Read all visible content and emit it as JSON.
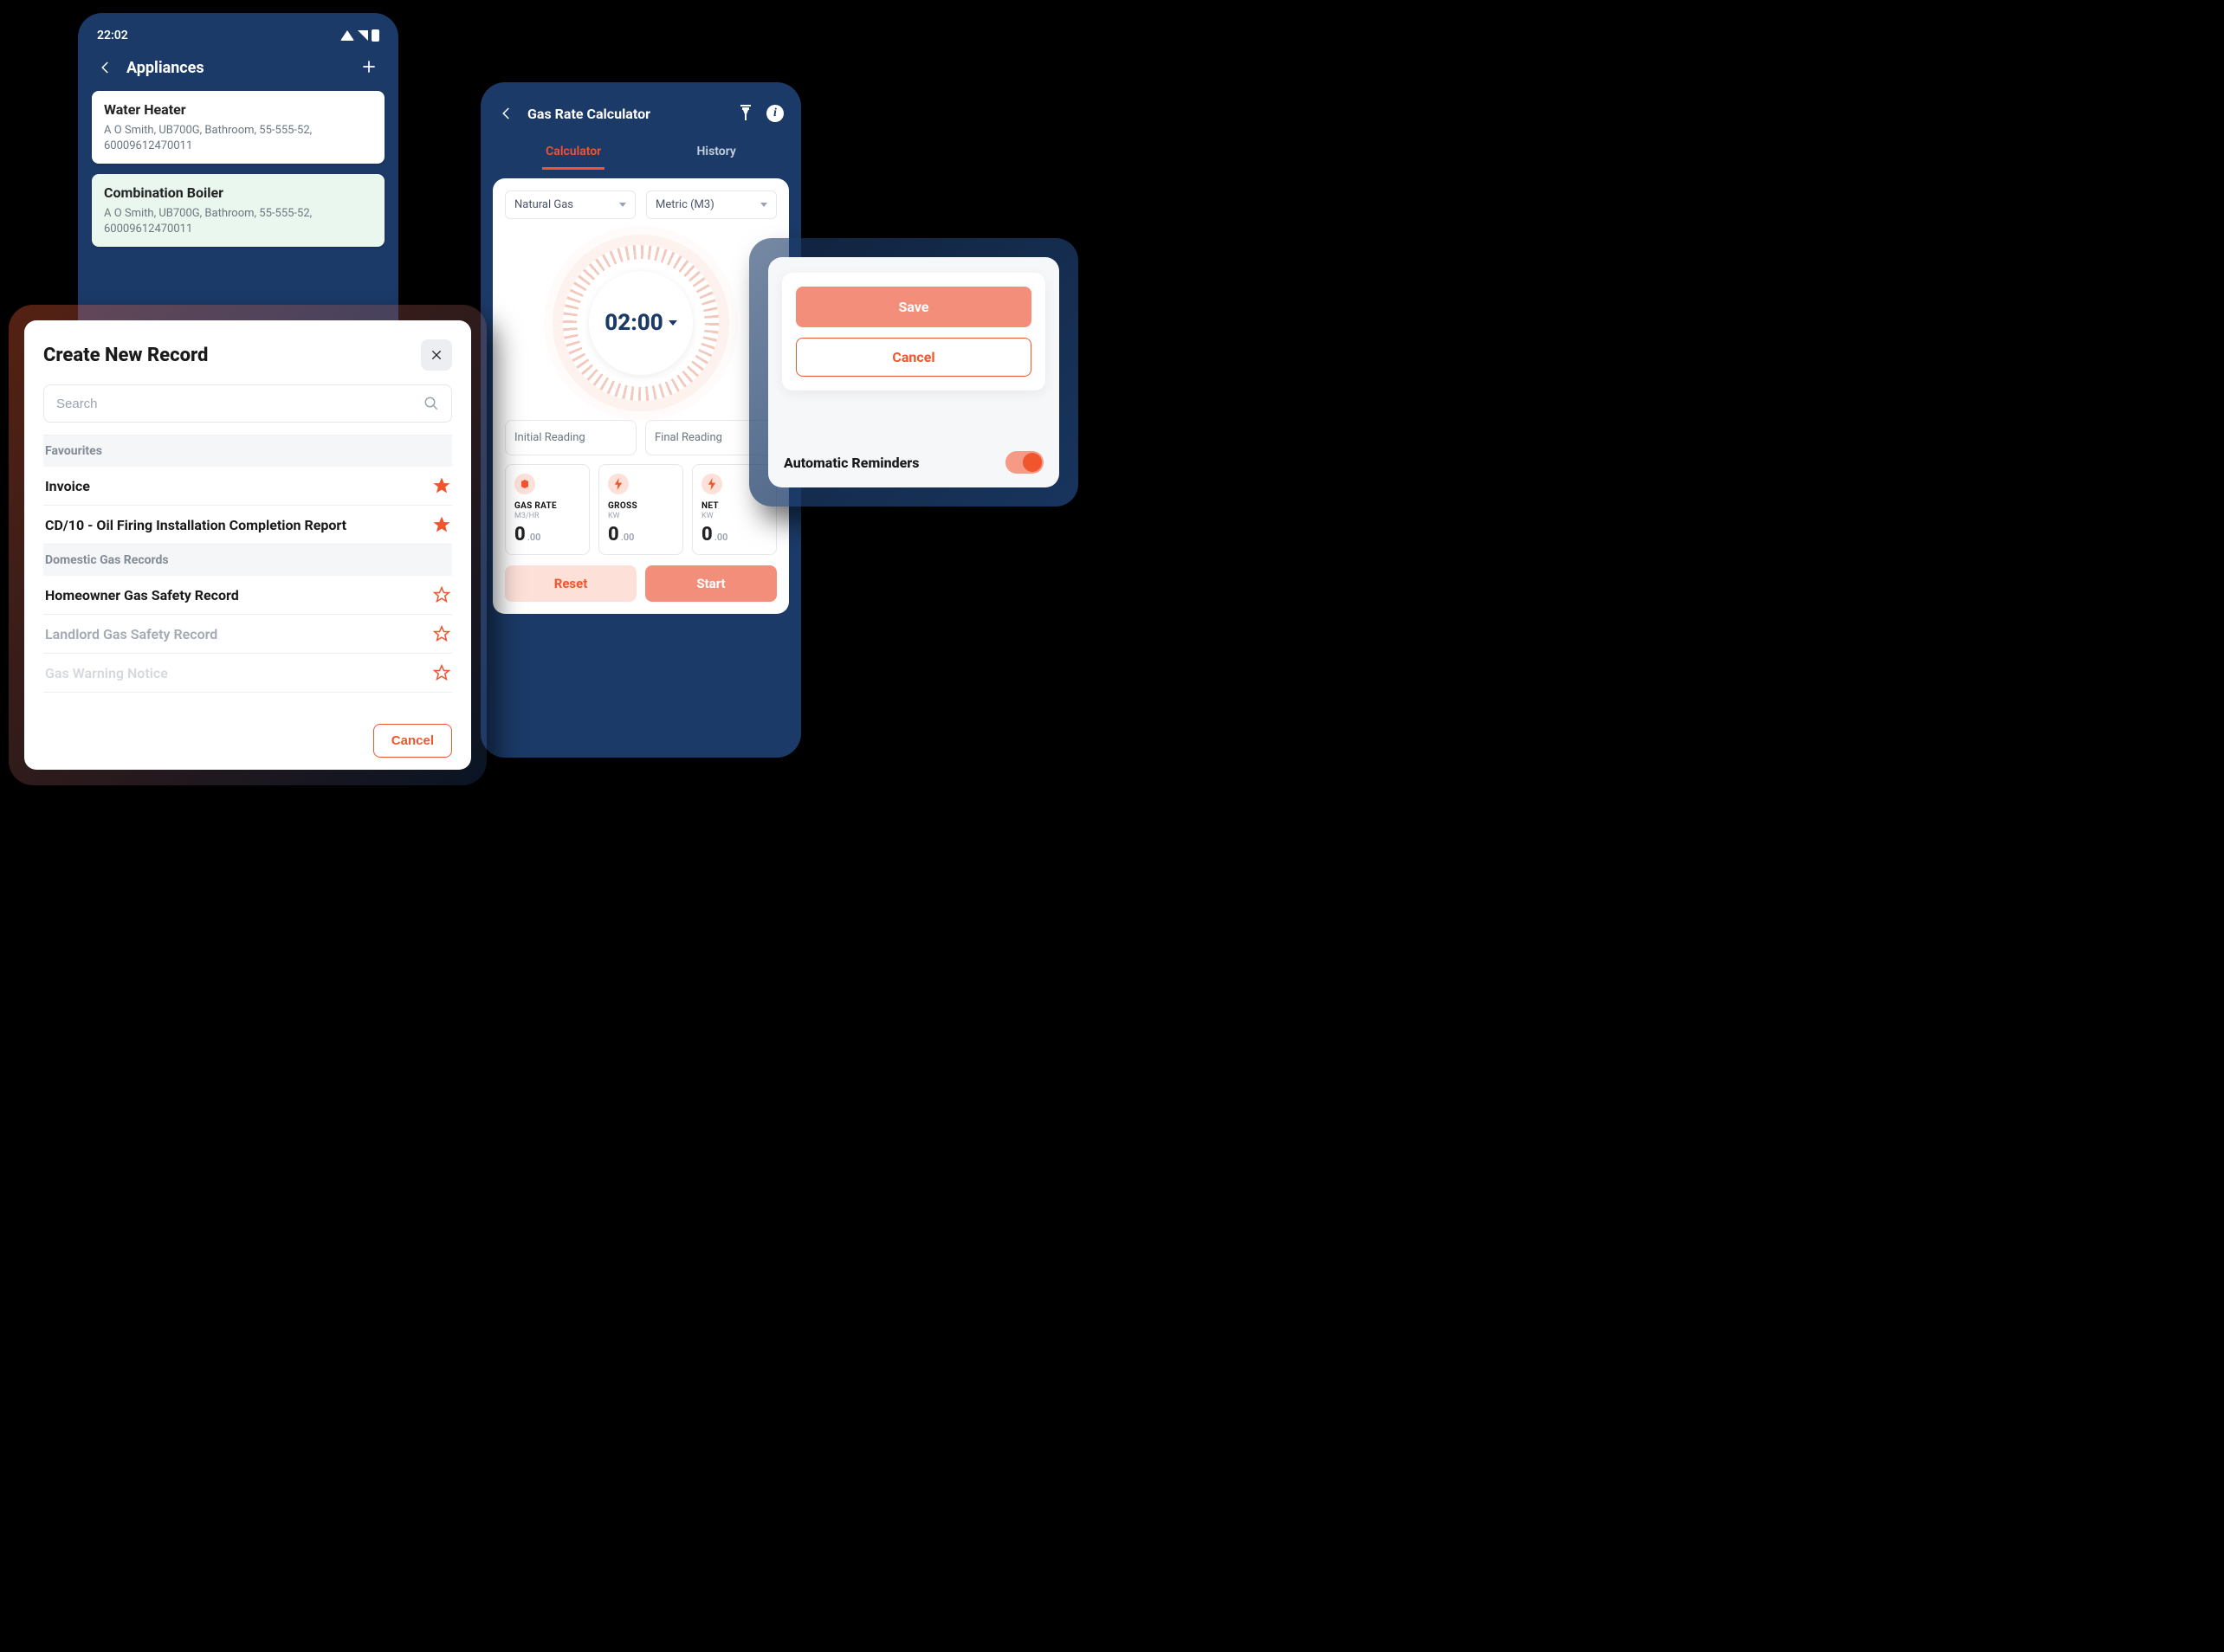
{
  "colors": {
    "navy": "#1b3a67",
    "accent": "#f1552e",
    "accent_light": "#f38e7a",
    "accent_bg": "#fde1d9"
  },
  "appliances_screen": {
    "status_time": "22:02",
    "title": "Appliances",
    "items": [
      {
        "name": "Water Heater",
        "details": "A O Smith, UB700G, Bathroom, 55-555-52, 60009612470011",
        "selected": false
      },
      {
        "name": "Combination Boiler",
        "details": "A O Smith, UB700G, Bathroom, 55-555-52, 60009612470011",
        "selected": true
      }
    ]
  },
  "calculator_screen": {
    "title": "Gas Rate Calculator",
    "tabs": {
      "active": "Calculator",
      "other": "History"
    },
    "fuel_select": "Natural Gas",
    "unit_select": "Metric (M3)",
    "timer": "02:00",
    "initial_reading_placeholder": "Initial Reading",
    "final_reading_placeholder": "Final Reading",
    "metrics": [
      {
        "label": "GAS RATE",
        "unit": "M3/HR",
        "value": "0",
        "decimal": ".00",
        "icon": "cube"
      },
      {
        "label": "GROSS",
        "unit": "KW",
        "value": "0",
        "decimal": ".00",
        "icon": "bolt"
      },
      {
        "label": "NET",
        "unit": "KW",
        "value": "0",
        "decimal": ".00",
        "icon": "bolt"
      }
    ],
    "reset_label": "Reset",
    "start_label": "Start"
  },
  "create_record_modal": {
    "title": "Create New Record",
    "search_placeholder": "Search",
    "sections": {
      "favourites_header": "Favourites",
      "domestic_header": "Domestic Gas Records"
    },
    "items": {
      "invoice": "Invoice",
      "cd10": "CD/10 - Oil Firing Installation Completion Report",
      "homeowner": "Homeowner Gas Safety Record",
      "landlord": "Landlord Gas Safety Record",
      "warning": "Gas Warning Notice"
    },
    "cancel_label": "Cancel"
  },
  "reminder_card": {
    "save_label": "Save",
    "cancel_label": "Cancel",
    "reminders_label": "Automatic Reminders",
    "toggle_on": true
  }
}
